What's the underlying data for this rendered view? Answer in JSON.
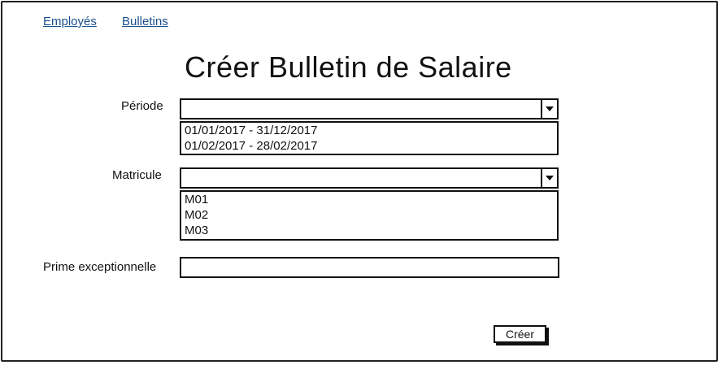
{
  "nav": {
    "employees_label": "Employés",
    "payslips_label": "Bulletins"
  },
  "page": {
    "title": "Créer Bulletin de Salaire"
  },
  "form": {
    "period": {
      "label": "Période",
      "selected_value": "",
      "options": [
        "01/01/2017 - 31/12/2017",
        "01/02/2017 - 28/02/2017"
      ]
    },
    "employee_id": {
      "label": "Matricule",
      "selected_value": "",
      "options": [
        "M01",
        "M02",
        "M03"
      ]
    },
    "bonus": {
      "label": "Prime exceptionnelle",
      "value": ""
    },
    "submit_label": "Créer"
  },
  "icons": {
    "dropdown": "chevron-down-icon"
  },
  "colors": {
    "link": "#1a4f8a",
    "border": "#111111",
    "background": "#ffffff"
  }
}
